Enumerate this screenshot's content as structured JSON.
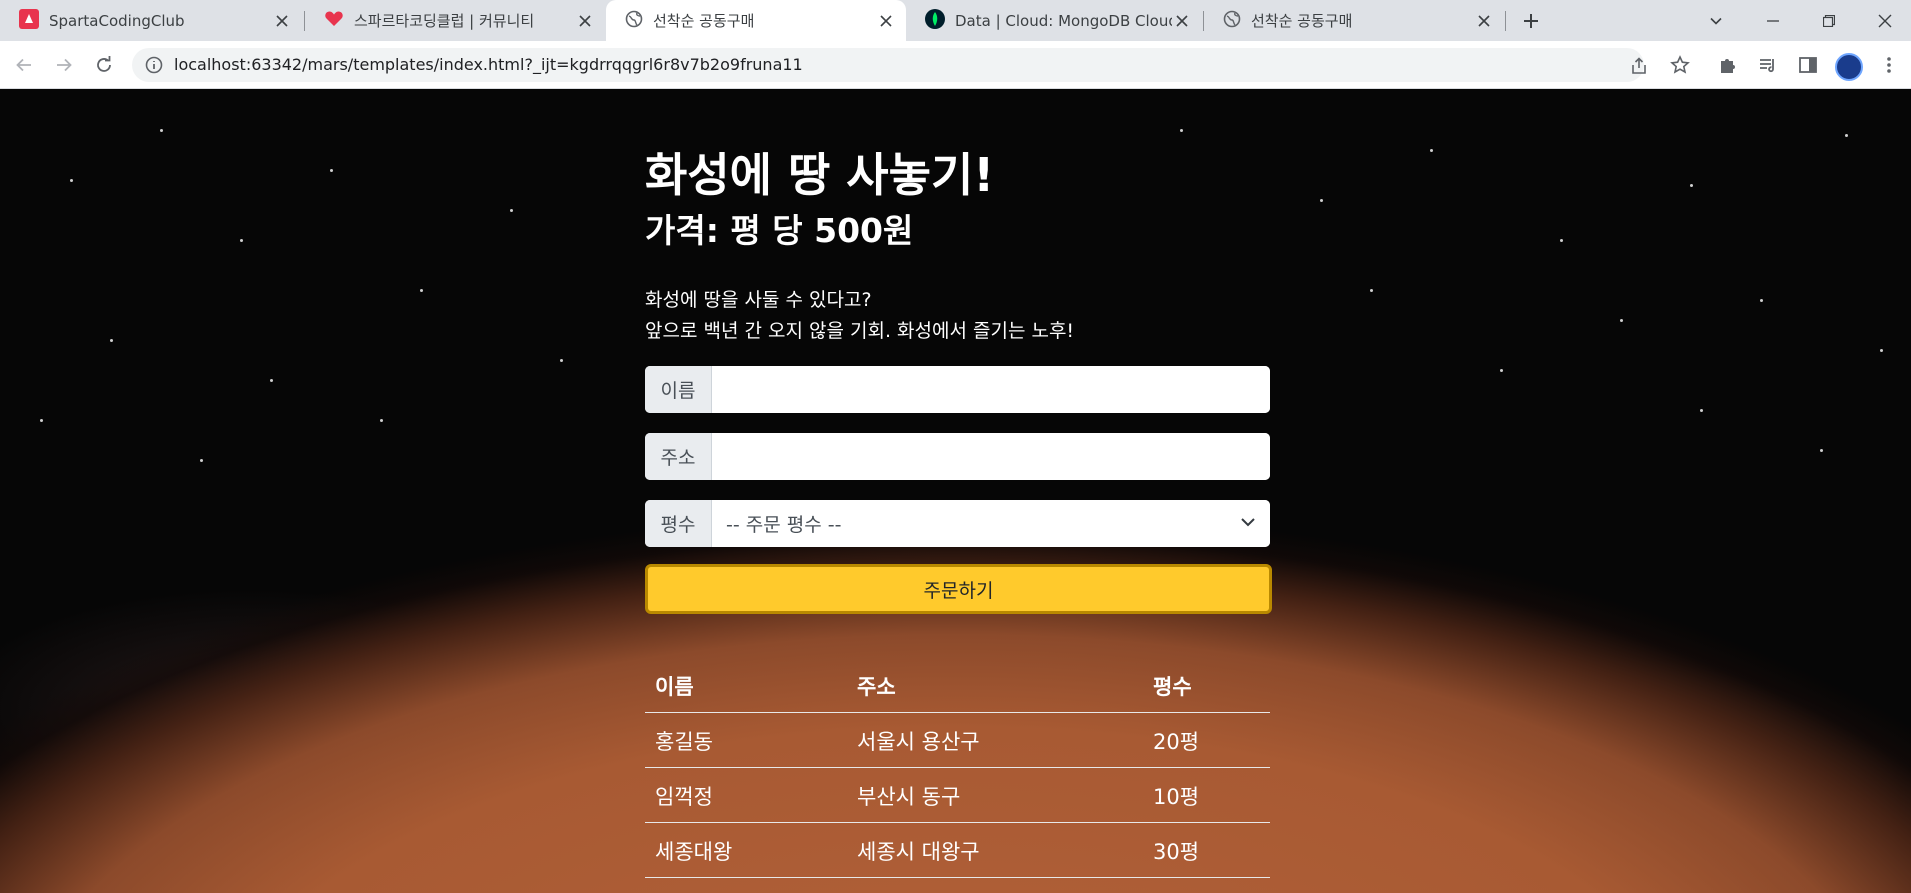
{
  "browser": {
    "tabs": [
      {
        "title": "SpartaCodingClub",
        "icon": "sparta-favicon-icon",
        "active": false
      },
      {
        "title": "스파르타코딩클럽 | 커뮤니티",
        "icon": "sparta-heart-favicon-icon",
        "active": false
      },
      {
        "title": "선착순 공동구매",
        "icon": "globe-icon",
        "active": true
      },
      {
        "title": "Data | Cloud: MongoDB Cloud",
        "icon": "mongodb-leaf-icon",
        "active": false
      },
      {
        "title": "선착순 공동구매",
        "icon": "globe-icon",
        "active": false
      }
    ],
    "url": "localhost:63342/mars/templates/index.html?_ijt=kgdrrqqgrl6r8v7b2o9fruna11"
  },
  "page": {
    "title": "화성에 땅 사놓기!",
    "price": "가격: 평 당 500원",
    "desc_line1": "화성에 땅을 사둘 수 있다고?",
    "desc_line2": "앞으로 백년 간 오지 않을 기회. 화성에서 즐기는 노후!",
    "form": {
      "name_label": "이름",
      "name_value": "",
      "address_label": "주소",
      "address_value": "",
      "size_label": "평수",
      "size_selected": "-- 주문 평수 --",
      "submit_label": "주문하기"
    },
    "table": {
      "headers": [
        "이름",
        "주소",
        "평수"
      ],
      "rows": [
        [
          "홍길동",
          "서울시 용산구",
          "20평"
        ],
        [
          "임꺽정",
          "부산시 동구",
          "10평"
        ],
        [
          "세종대왕",
          "세종시 대왕구",
          "30평"
        ]
      ]
    }
  },
  "colors": {
    "order_button": "#ffca2c",
    "active_tab": "#ffffff",
    "tabstrip": "#dee1e6"
  }
}
